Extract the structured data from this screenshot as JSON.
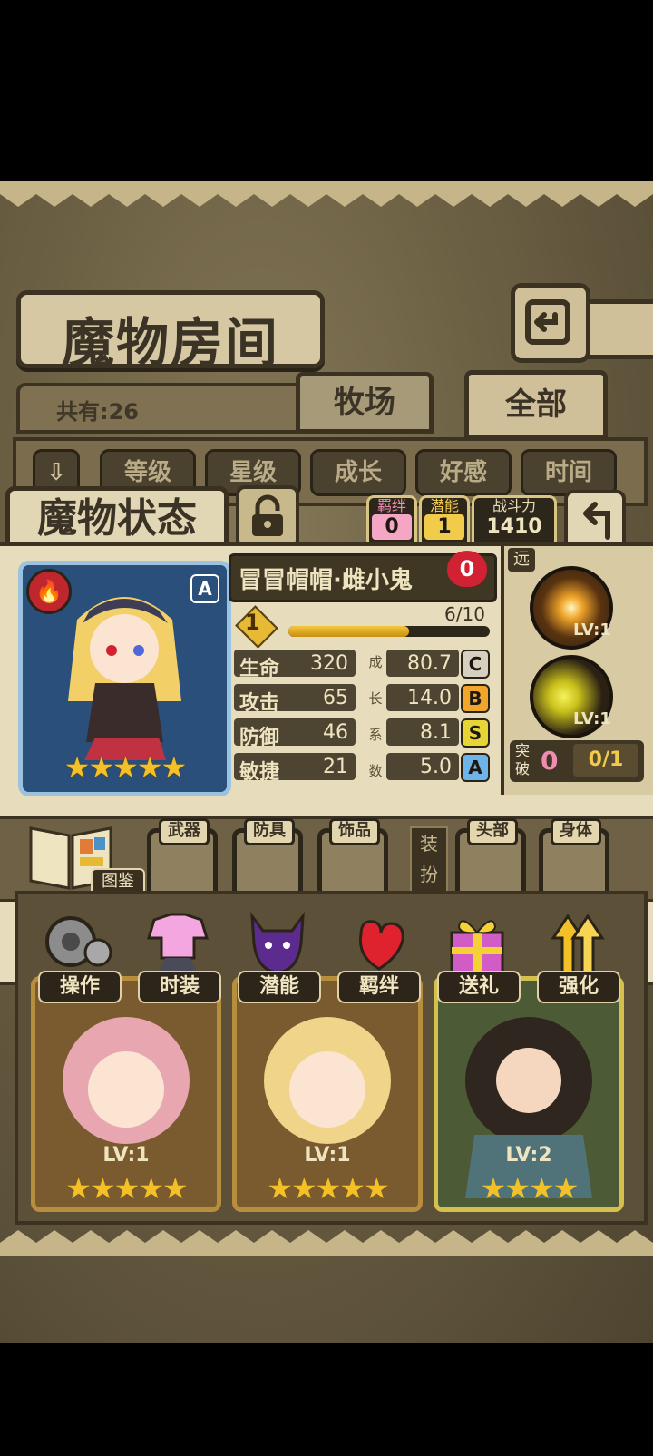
{
  "header": {
    "title": "魔物房间"
  },
  "count": {
    "text": "共有:26"
  },
  "tabs": {
    "ranch": "牧场",
    "all": "全部"
  },
  "sort": {
    "toggle": "⇩",
    "items": [
      "等级",
      "星级",
      "成长",
      "好感",
      "时间"
    ]
  },
  "status": {
    "title": "魔物状态"
  },
  "mini_stats": {
    "bond": {
      "label": "羁绊",
      "value": "0"
    },
    "potential": {
      "label": "潜能",
      "value": "1"
    },
    "power": {
      "label": "战斗力",
      "value": "1410"
    }
  },
  "monster": {
    "name": "冒冒帽帽·雌小鬼",
    "affection": "0",
    "rank_badge": "A",
    "element_icon": "fire-icon",
    "stars": "★★★★★",
    "level": "1",
    "xp_text": "6/10",
    "xp_fraction": 0.6,
    "growth_label": "成长系数",
    "stats": [
      {
        "label": "生命",
        "value": "320",
        "growth": "80.7",
        "grade": "C",
        "color": "#d7d0c0"
      },
      {
        "label": "攻击",
        "value": "65",
        "growth": "14.0",
        "grade": "B",
        "color": "#f0a52b"
      },
      {
        "label": "防御",
        "value": "46",
        "growth": "8.1",
        "grade": "S",
        "color": "#e6d534"
      },
      {
        "label": "敏捷",
        "value": "21",
        "growth": "5.0",
        "grade": "A",
        "color": "#6fb4e8"
      }
    ]
  },
  "skills": {
    "range": "远",
    "skill1_lv": "LV:1",
    "skill2_lv": "LV:1",
    "break_label": "突破",
    "break_count": "0",
    "break_progress": "0/1"
  },
  "equip": {
    "book_label": "图鉴",
    "dress_label": "装扮",
    "slots": [
      "武器",
      "防具",
      "饰品",
      "头部",
      "身体"
    ]
  },
  "actions": [
    "操作",
    "时装",
    "潜能",
    "羁绊",
    "送礼",
    "强化"
  ],
  "grid": {
    "cards": [
      {
        "lv": "LV:1",
        "stars": "★★★★★"
      },
      {
        "lv": "LV:1",
        "stars": "★★★★★"
      },
      {
        "lv": "LV:2",
        "stars": "★★★★"
      }
    ]
  }
}
